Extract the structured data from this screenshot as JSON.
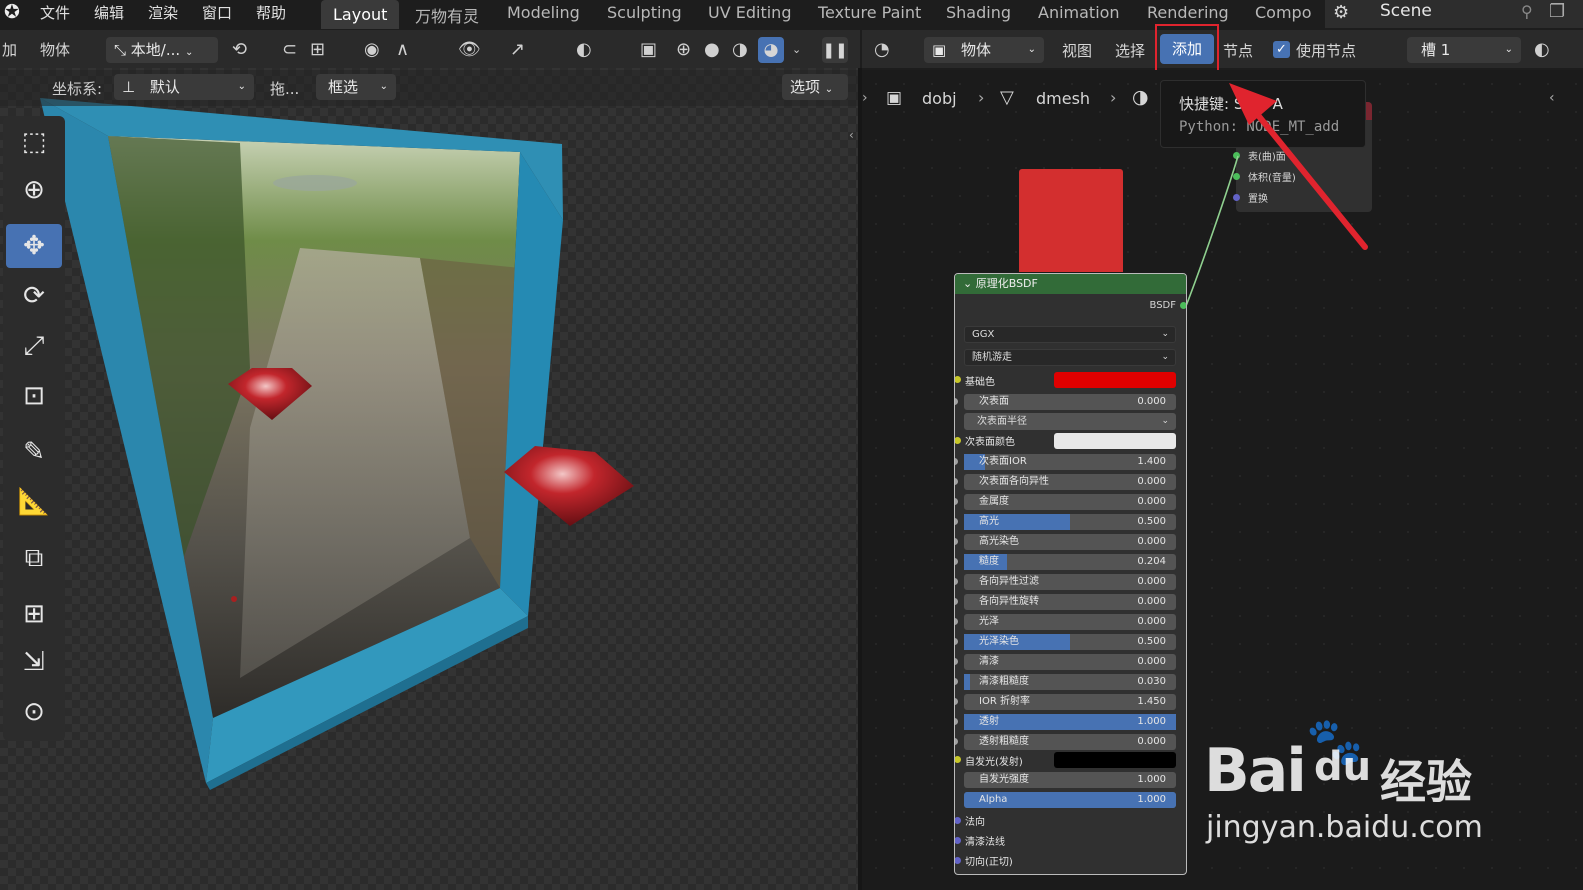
{
  "menu": {
    "items": [
      "文件",
      "编辑",
      "渲染",
      "窗口",
      "帮助"
    ]
  },
  "workspaces": [
    "Layout",
    "万物有灵",
    "Modeling",
    "Sculpting",
    "UV Editing",
    "Texture Paint",
    "Shading",
    "Animation",
    "Rendering",
    "Compo"
  ],
  "scene": "Scene",
  "viewport_header": {
    "add_label": "加",
    "object_label": "物体",
    "transform": "本地/..."
  },
  "viewport_sub": {
    "coord_label": "坐标系:",
    "coord_value": "默认",
    "drag_label": "拖...",
    "select_mode": "框选",
    "options": "选项"
  },
  "node_header": {
    "object_mode": "物体",
    "view": "视图",
    "select": "选择",
    "add": "添加",
    "node": "节点",
    "use_nodes": "使用节点",
    "slot": "槽 1"
  },
  "breadcrumb": {
    "object": "dobj",
    "mesh": "dmesh"
  },
  "tooltip": {
    "shortcut": "快捷键: Shift A",
    "python": "Python: NODE_MT_add"
  },
  "output_node": {
    "sockets": [
      "表(曲)面",
      "体积(音量)",
      "置换"
    ]
  },
  "bsdf": {
    "title": "原理化BSDF",
    "output": "BSDF",
    "distribution": "GGX",
    "subsurface_method": "随机游走",
    "base_color_label": "基础色",
    "subsurface_radius": "次表面半径",
    "subsurface_color_label": "次表面颜色",
    "emission_label": "自发光(发射)",
    "rows": [
      {
        "label": "次表面",
        "value": "0.000",
        "fill": 0
      },
      {
        "label": "次表面IOR",
        "value": "1.400",
        "fill": 0.1
      },
      {
        "label": "次表面各向异性",
        "value": "0.000",
        "fill": 0
      },
      {
        "label": "金属度",
        "value": "0.000",
        "fill": 0
      },
      {
        "label": "高光",
        "value": "0.500",
        "fill": 0.5
      },
      {
        "label": "高光染色",
        "value": "0.000",
        "fill": 0
      },
      {
        "label": "糙度",
        "value": "0.204",
        "fill": 0.204
      },
      {
        "label": "各向异性过滤",
        "value": "0.000",
        "fill": 0
      },
      {
        "label": "各向异性旋转",
        "value": "0.000",
        "fill": 0
      },
      {
        "label": "光泽",
        "value": "0.000",
        "fill": 0
      },
      {
        "label": "光泽染色",
        "value": "0.500",
        "fill": 0.5
      },
      {
        "label": "清漆",
        "value": "0.000",
        "fill": 0
      },
      {
        "label": "清漆粗糙度",
        "value": "0.030",
        "fill": 0.03
      },
      {
        "label": "IOR 折射率",
        "value": "1.450",
        "fill": 0
      },
      {
        "label": "透射",
        "value": "1.000",
        "fill": 1
      },
      {
        "label": "透射粗糙度",
        "value": "0.000",
        "fill": 0
      }
    ],
    "rows2": [
      {
        "label": "自发光强度",
        "value": "1.000",
        "fill": 0
      },
      {
        "label": "Alpha",
        "value": "1.000",
        "fill": 1
      }
    ],
    "vectors": [
      "法向",
      "清漆法线",
      "切向(正切)"
    ]
  },
  "colors": {
    "base": "#e00000",
    "accent": "#4772b3",
    "highlight": "#e0242e"
  },
  "watermark": {
    "brand": "Bai",
    "brand2": "du",
    "cn": "经验",
    "url": "jingyan.baidu.com"
  }
}
